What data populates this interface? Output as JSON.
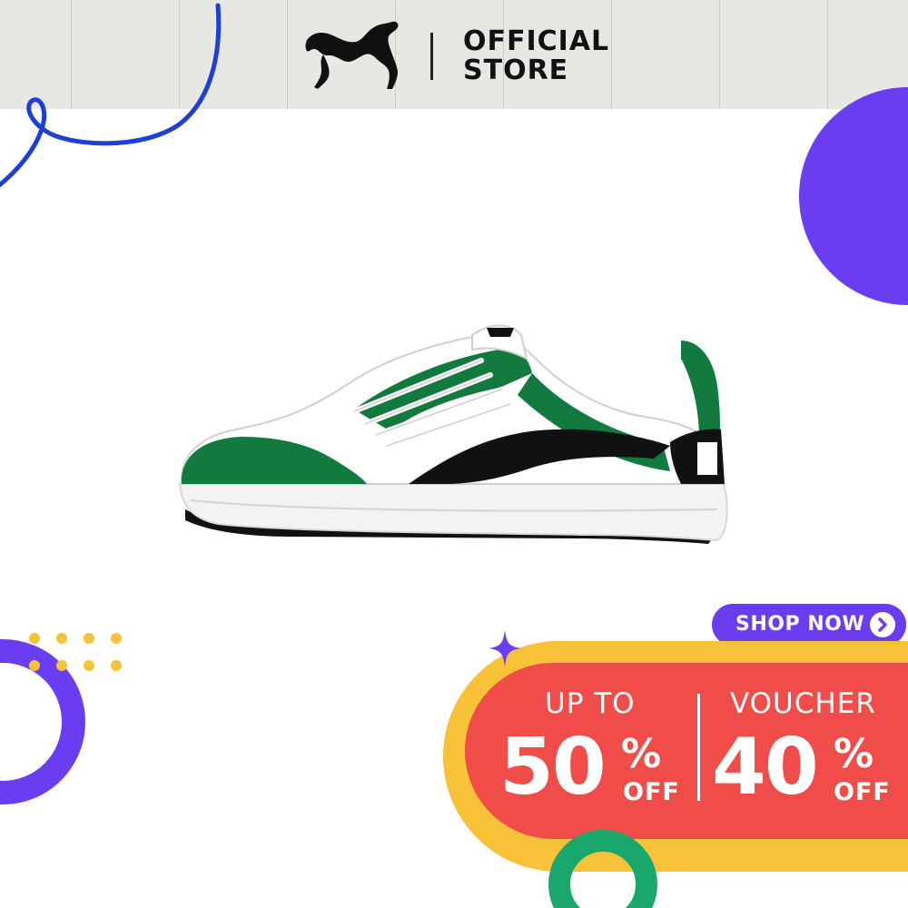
{
  "brand": {
    "name": "PUMA",
    "store_line1": "OFFICIAL",
    "store_line2": "STORE"
  },
  "product": {
    "image": "sneaker-image",
    "shoe_colors": {
      "upper": "#ffffff",
      "overlay": "#137a3f",
      "formstrip": "#111111",
      "sole": "#f3f3f3"
    }
  },
  "cta": {
    "label": "SHOP NOW",
    "icon": "chevron-right-icon"
  },
  "promo": {
    "left_top": "UP TO",
    "left_value": "50",
    "left_pct": "%",
    "left_off": "OFF",
    "right_top": "VOUCHER",
    "right_value": "40",
    "right_pct": "%",
    "right_off": "OFF"
  },
  "colors": {
    "header_bg": "#e7e7e3",
    "accent_purple": "#6b3df0",
    "accent_yellow": "#f7c238",
    "accent_red": "#f04d4a",
    "accent_green": "#19a76b",
    "accent_blue": "#1e3fd6"
  }
}
